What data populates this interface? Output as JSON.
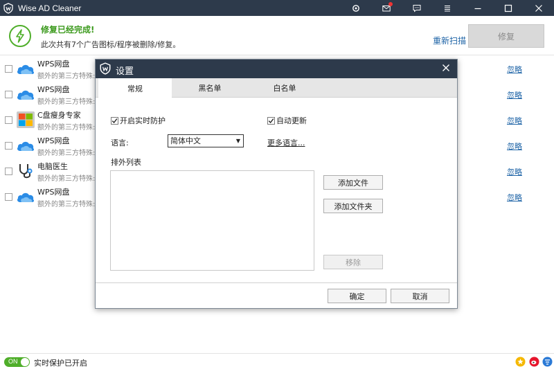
{
  "window": {
    "title": "Wise AD Cleaner",
    "icons": [
      "settings-gear-icon",
      "mail-icon",
      "feedback-icon",
      "menu-icon",
      "minimize-icon",
      "maximize-icon",
      "close-icon"
    ]
  },
  "header": {
    "status_title": "修复已经完成!",
    "status_desc": "此次共有7个广告图标/程序被删除/修复。",
    "rescan_label": "重新扫描",
    "repair_label": "修复"
  },
  "list": {
    "items": [
      {
        "name": "WPS网盘",
        "desc": "额外的第三方特殊:",
        "icon": "cloud-icon",
        "action": "忽略"
      },
      {
        "name": "WPS网盘",
        "desc": "额外的第三方特殊:",
        "icon": "cloud-icon",
        "action": "忽略"
      },
      {
        "name": "C盘瘦身专家",
        "desc": "额外的第三方特殊:",
        "icon": "windows-icon",
        "action": "忽略"
      },
      {
        "name": "WPS网盘",
        "desc": "额外的第三方特殊:",
        "icon": "cloud-icon",
        "action": "忽略"
      },
      {
        "name": "电脑医生",
        "desc": "额外的第三方特殊:",
        "icon": "stethoscope-icon",
        "action": "忽略"
      },
      {
        "name": "WPS网盘",
        "desc": "额外的第三方特殊:",
        "icon": "cloud-icon",
        "action": "忽略"
      }
    ]
  },
  "footer": {
    "toggle_label": "ON",
    "protect_text": "实时保护已开启"
  },
  "dialog": {
    "title": "设置",
    "tabs": [
      {
        "label": "常规",
        "active": true
      },
      {
        "label": "黑名单",
        "active": false
      },
      {
        "label": "白名单",
        "active": false
      }
    ],
    "realtime_label": "开启实时防护",
    "realtime_checked": true,
    "autoupdate_label": "自动更新",
    "autoupdate_checked": true,
    "language_label": "语言:",
    "language_value": "简体中文",
    "more_languages": "更多语言...",
    "exclusion_label": "排外列表",
    "add_file": "添加文件",
    "add_folder": "添加文件夹",
    "remove": "移除",
    "ok": "确定",
    "cancel": "取消"
  },
  "colors": {
    "titlebar": "#2d3a4b",
    "accent_green": "#4fae2a",
    "link_blue": "#1d63a6"
  }
}
